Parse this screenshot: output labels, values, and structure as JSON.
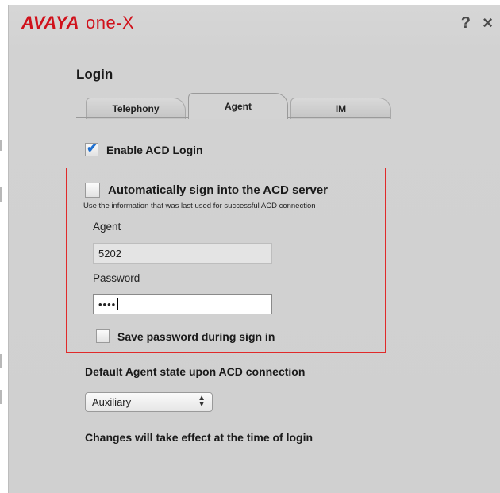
{
  "header": {
    "brand_avaya": "AVAYA",
    "brand_onex": "one-X",
    "help_icon": "?",
    "close_icon": "×"
  },
  "page": {
    "title": "Login"
  },
  "tabs": [
    {
      "label": "Telephony",
      "active": false
    },
    {
      "label": "Agent",
      "active": true
    },
    {
      "label": "IM",
      "active": false
    }
  ],
  "enable_acd": {
    "label": "Enable ACD Login",
    "checked": true
  },
  "acd_section": {
    "auto_sign_in_label": "Automatically sign into the ACD server",
    "auto_sign_in_checked": false,
    "hint": "Use the information that was last used for successful ACD connection",
    "agent_label": "Agent",
    "agent_value": "5202",
    "password_label": "Password",
    "password_value": "••••",
    "save_password_label": "Save password during sign in",
    "save_password_checked": false
  },
  "default_state": {
    "label": "Default Agent state upon ACD connection",
    "selected": "Auxiliary"
  },
  "footer_note": "Changes will take effect at the time of login",
  "colors": {
    "brand_red": "#d0111b",
    "check_blue": "#1e6fd0",
    "highlight_red": "#e02a2a"
  }
}
